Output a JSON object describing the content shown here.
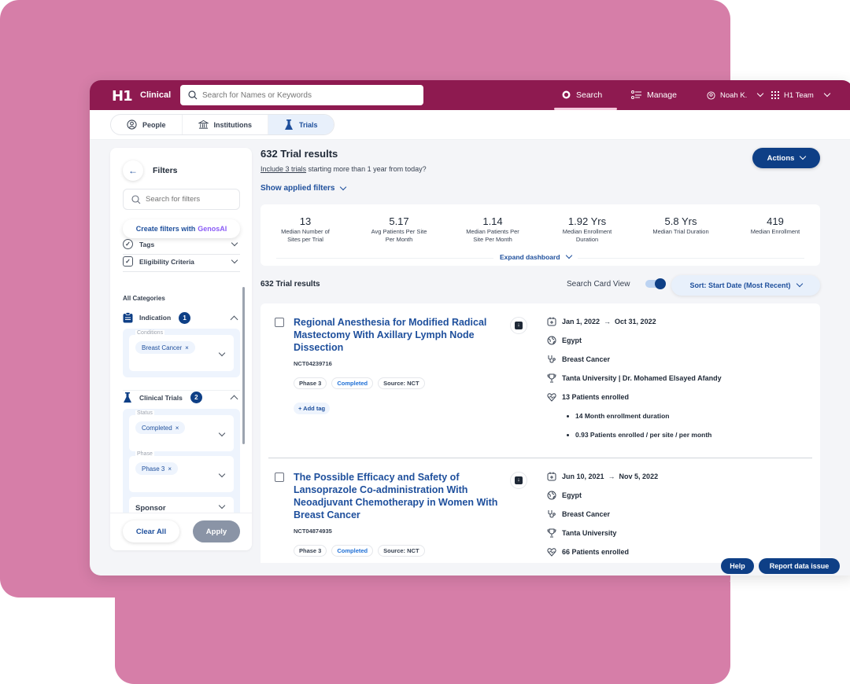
{
  "colors": {
    "brand": "#8e1a50",
    "primary": "#0e3f86",
    "link": "#1e4f9c",
    "background_shape": "#d67ea8",
    "genos_ai": "#8b5cf6"
  },
  "header": {
    "logo": "H1",
    "product": "Clinical",
    "search_placeholder": "Search for Names or Keywords",
    "nav": [
      {
        "label": "Search",
        "icon": "search-icon",
        "active": true
      },
      {
        "label": "Manage",
        "icon": "list-icon"
      }
    ],
    "user": {
      "label": "Noah K.",
      "icon": "user-circle-icon"
    },
    "team": {
      "label": "H1 Team",
      "icon": "grid-icon"
    }
  },
  "tabs": [
    {
      "label": "People",
      "icon": "person-icon"
    },
    {
      "label": "Institutions",
      "icon": "institution-icon"
    },
    {
      "label": "Trials",
      "icon": "flask-icon",
      "active": true
    }
  ],
  "sidebar": {
    "title": "Filters",
    "search_placeholder": "Search for filters",
    "genos_prefix": "Create filters with",
    "genos_ai": "GenosAI",
    "rows": [
      {
        "label": "Tags"
      },
      {
        "label": "Eligibility Criteria"
      }
    ],
    "all_categories": "All Categories",
    "categories": [
      {
        "label": "Indication",
        "count": "1",
        "fields": [
          {
            "label": "Conditions",
            "chips": [
              "Breast Cancer"
            ]
          }
        ]
      },
      {
        "label": "Clinical Trials",
        "count": "2",
        "fields": [
          {
            "label": "Status",
            "chips": [
              "Completed"
            ]
          },
          {
            "label": "Phase",
            "chips": [
              "Phase 3"
            ]
          }
        ],
        "collapsed_fields": [
          "Sponsor"
        ]
      }
    ],
    "clear_label": "Clear All",
    "apply_label": "Apply"
  },
  "main": {
    "results_title": "632 Trial results",
    "include_link": "Include 3 trials",
    "include_rest": " starting more than 1 year from today?",
    "show_filters": "Show applied filters",
    "actions_label": "Actions",
    "dashboard": {
      "stats": [
        {
          "value": "13",
          "label": "Median Number of Sites per Trial"
        },
        {
          "value": "5.17",
          "label": "Avg Patients Per Site Per Month"
        },
        {
          "value": "1.14",
          "label": "Median Patients Per Site Per Month"
        },
        {
          "value": "1.92 Yrs",
          "label": "Median Enrollment Duration"
        },
        {
          "value": "5.8 Yrs",
          "label": "Median Trial Duration"
        },
        {
          "value": "419",
          "label": "Median Enrollment"
        }
      ],
      "expand_label": "Expand dashboard"
    },
    "results_sub": "632 Trial results",
    "card_view_label": "Search Card View",
    "card_view_on": true,
    "sort_label": "Sort: Start Date (Most Recent)",
    "trials": [
      {
        "title": "Regional Anesthesia for Modified Radical Mastectomy With Axillary Lymph Node Dissection",
        "nct": "NCT04239716",
        "phase": "Phase 3",
        "status": "Completed",
        "source": "Source: NCT",
        "add_tag": "+ Add tag",
        "start": "Jan 1, 2022",
        "end": "Oct 31, 2022",
        "country": "Egypt",
        "condition": "Breast Cancer",
        "sponsor": "Tanta University | Dr. Mohamed Elsayed Afandy",
        "enrolled": "13 Patients enrolled",
        "details": [
          "14 Month enrollment duration",
          "0.93 Patients enrolled / per site / per month"
        ]
      },
      {
        "title": "The Possible Efficacy and Safety of Lansoprazole Co-administration With Neoadjuvant Chemotherapy in Women With Breast Cancer",
        "nct": "NCT04874935",
        "phase": "Phase 3",
        "status": "Completed",
        "source": "Source: NCT",
        "start": "Jun 10, 2021",
        "end": "Nov 5, 2022",
        "country": "Egypt",
        "condition": "Breast Cancer",
        "sponsor": "Tanta University",
        "enrolled": "66 Patients enrolled"
      }
    ]
  },
  "footer": {
    "help_label": "Help",
    "report_label": "Report data issue"
  }
}
